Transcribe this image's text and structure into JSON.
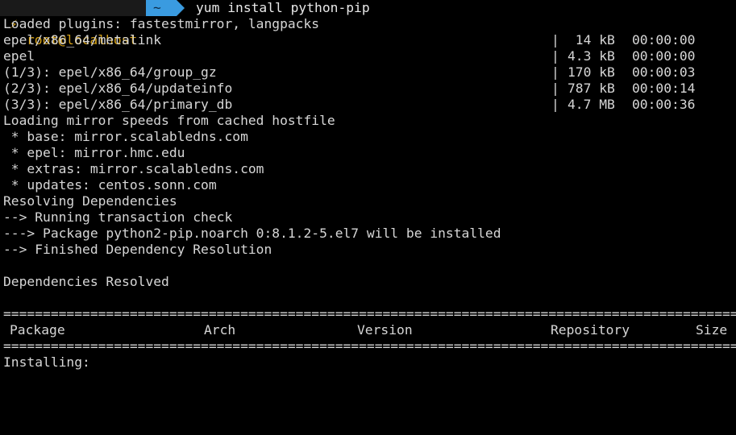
{
  "prompt": {
    "bolt_icon": "⚡",
    "user_host": "root@localhost",
    "dir": "~",
    "command": "yum install python-pip"
  },
  "lines": {
    "l1": "Loaded plugins: fastestmirror, langpacks",
    "repos": [
      {
        "name": "epel/x86_64/metalink",
        "sep": "|",
        "size": " 14 kB",
        "time": "00:00:00"
      },
      {
        "name": "epel",
        "sep": "|",
        "size": "4.3 kB",
        "time": "00:00:00"
      },
      {
        "name": "(1/3): epel/x86_64/group_gz",
        "sep": "|",
        "size": "170 kB",
        "time": "00:00:03"
      },
      {
        "name": "(2/3): epel/x86_64/updateinfo",
        "sep": "|",
        "size": "787 kB",
        "time": "00:00:14"
      },
      {
        "name": "(3/3): epel/x86_64/primary_db",
        "sep": "|",
        "size": "4.7 MB",
        "time": "00:00:36"
      }
    ],
    "l7": "Loading mirror speeds from cached hostfile",
    "l8": " * base: mirror.scalabledns.com",
    "l9": " * epel: mirror.hmc.edu",
    "l10": " * extras: mirror.scalabledns.com",
    "l11": " * updates: centos.sonn.com",
    "l12": "Resolving Dependencies",
    "l13": "--> Running transaction check",
    "l14": "---> Package python2-pip.noarch 0:8.1.2-5.el7 will be installed",
    "l15": "--> Finished Dependency Resolution",
    "l17": "Dependencies Resolved",
    "rule": "==========================================================================================================",
    "table_header": {
      "package": "Package",
      "arch": "Arch",
      "version": "Version",
      "repository": "Repository",
      "size": "Size"
    },
    "l22": "Installing:"
  }
}
